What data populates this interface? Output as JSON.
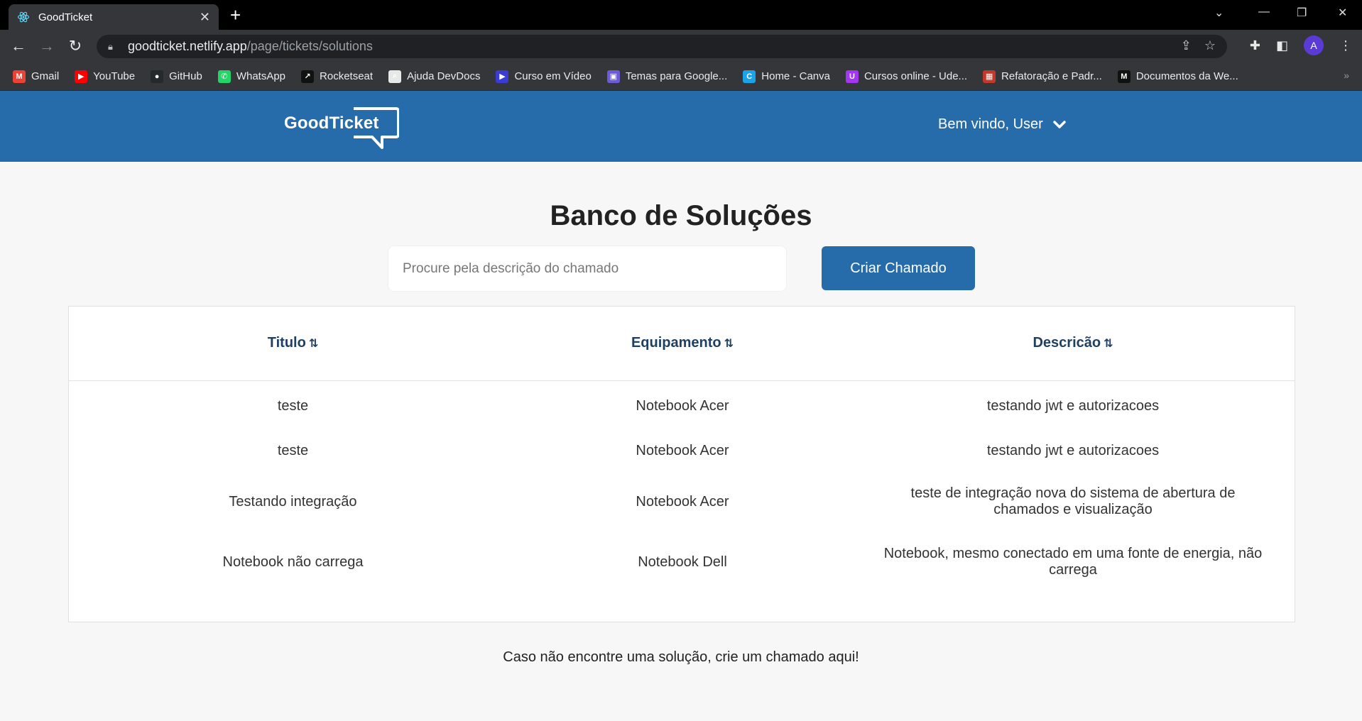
{
  "browser": {
    "tab_title": "GoodTicket",
    "url_host": "goodticket.netlify.app",
    "url_path": "/page/tickets/solutions",
    "profile_initial": "A",
    "bookmarks": [
      {
        "label": "Gmail",
        "icon": "gmail-icon",
        "color": "#ea4335",
        "glyph": "M"
      },
      {
        "label": "YouTube",
        "icon": "youtube-icon",
        "color": "#ff0000",
        "glyph": "▶"
      },
      {
        "label": "GitHub",
        "icon": "github-icon",
        "color": "#24292e",
        "glyph": "●"
      },
      {
        "label": "WhatsApp",
        "icon": "whatsapp-icon",
        "color": "#25d366",
        "glyph": "✆"
      },
      {
        "label": "Rocketseat",
        "icon": "rocketseat-icon",
        "color": "#111111",
        "glyph": "↗"
      },
      {
        "label": "Ajuda DevDocs",
        "icon": "devdocs-icon",
        "color": "#e8e8e8",
        "glyph": "⌕"
      },
      {
        "label": "Curso em Vídeo",
        "icon": "cursoemvideo-icon",
        "color": "#3b3bd6",
        "glyph": "▶"
      },
      {
        "label": "Temas para Google...",
        "icon": "themes-icon",
        "color": "#6b5bd6",
        "glyph": "▣"
      },
      {
        "label": "Home - Canva",
        "icon": "canva-icon",
        "color": "#1aa3e8",
        "glyph": "C"
      },
      {
        "label": "Cursos online - Ude...",
        "icon": "udemy-icon",
        "color": "#a435f0",
        "glyph": "U"
      },
      {
        "label": "Refatoração e Padr...",
        "icon": "refactoring-icon",
        "color": "#c0392b",
        "glyph": "▦"
      },
      {
        "label": "Documentos da We...",
        "icon": "mdn-icon",
        "color": "#111111",
        "glyph": "M"
      }
    ]
  },
  "header": {
    "logo_text": "GoodTicket",
    "welcome": "Bem vindo, User"
  },
  "main": {
    "title": "Banco de Soluções",
    "search_placeholder": "Procure pela descrição do chamado",
    "create_button": "Criar Chamado",
    "columns": [
      "Titulo",
      "Equipamento",
      "Descricão"
    ],
    "rows": [
      {
        "titulo": "teste",
        "equipamento": "Notebook Acer",
        "descricao": "testando jwt e autorizacoes"
      },
      {
        "titulo": "teste",
        "equipamento": "Notebook Acer",
        "descricao": "testando jwt e autorizacoes"
      },
      {
        "titulo": "Testando integração",
        "equipamento": "Notebook Acer",
        "descricao": "teste de integração nova do sistema de abertura de chamados e visualização"
      },
      {
        "titulo": "Notebook não carrega",
        "equipamento": "Notebook Dell",
        "descricao": "Notebook, mesmo conectado em uma fonte de energia, não carrega"
      }
    ],
    "footer_note": "Caso não encontre uma solução, crie um chamado aqui!"
  },
  "colors": {
    "brand": "#266caa",
    "header_text": "#1f3f63"
  }
}
